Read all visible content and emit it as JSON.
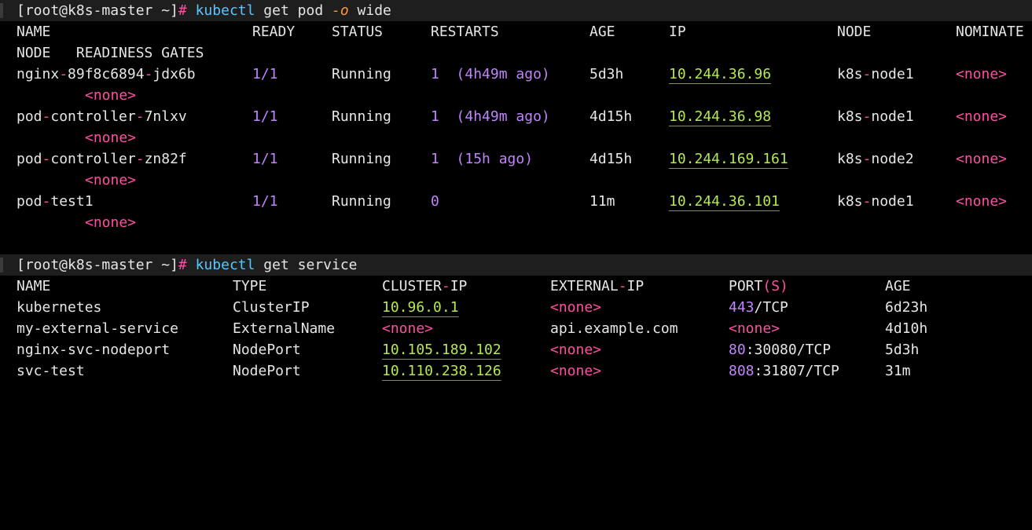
{
  "prompt": {
    "user_host": "[root@k8s-master ~]",
    "hash": "#"
  },
  "cmd1": {
    "program": "kubectl",
    "args": "get pod",
    "flag": "-o",
    "rest": "wide"
  },
  "pods": {
    "headers": [
      "NAME",
      "READY",
      "STATUS",
      "RESTARTS",
      "AGE",
      "IP",
      "NODE",
      "NOMINATE"
    ],
    "header2": "NODE   READINESS GATES",
    "rows": [
      {
        "name_a": "nginx",
        "name_b": "89f8c6894",
        "name_c": "jdx6b",
        "ready": "1/1",
        "status": "Running",
        "restarts_n": "1",
        "restarts_t": "(4h49m ago)",
        "age": "5d3h",
        "ip": "10.244.36.96",
        "node_a": "k8s",
        "node_b": "node1",
        "nominated": "<none>",
        "gates": "<none>"
      },
      {
        "name_a": "pod",
        "name_b": "controller",
        "name_c": "7nlxv",
        "ready": "1/1",
        "status": "Running",
        "restarts_n": "1",
        "restarts_t": "(4h49m ago)",
        "age": "4d15h",
        "ip": "10.244.36.98",
        "node_a": "k8s",
        "node_b": "node1",
        "nominated": "<none>",
        "gates": "<none>"
      },
      {
        "name_a": "pod",
        "name_b": "controller",
        "name_c": "zn82f",
        "ready": "1/1",
        "status": "Running",
        "restarts_n": "1",
        "restarts_t": "(15h ago)",
        "age": "4d15h",
        "ip": "10.244.169.161",
        "node_a": "k8s",
        "node_b": "node2",
        "nominated": "<none>",
        "gates": "<none>"
      },
      {
        "name_a": "pod",
        "name_b": "test1",
        "name_c": "",
        "ready": "1/1",
        "status": "Running",
        "restarts_n": "0",
        "restarts_t": "",
        "age": "11m",
        "ip": "10.244.36.101",
        "node_a": "k8s",
        "node_b": "node1",
        "nominated": "<none>",
        "gates": "<none>"
      }
    ]
  },
  "cmd2": {
    "program": "kubectl",
    "args": "get service"
  },
  "services": {
    "headers": [
      "NAME",
      "TYPE",
      "CLUSTER",
      "IP",
      "EXTERNAL",
      "IP",
      "PORT",
      "(S)",
      "AGE"
    ],
    "rows": [
      {
        "name": "kubernetes",
        "type": "ClusterIP",
        "cluster_ip": "10.96.0.1",
        "external_ip": "<none>",
        "port_a": "443",
        "port_b": "/TCP",
        "age": "6d23h"
      },
      {
        "name": "my-external-service",
        "type": "ExternalName",
        "cluster_ip": "<none>",
        "external_ip": "api.example.com",
        "port_a": "<none>",
        "port_b": "",
        "age": "4d10h"
      },
      {
        "name": "nginx-svc-nodeport",
        "type": "NodePort",
        "cluster_ip": "10.105.189.102",
        "external_ip": "<none>",
        "port_a": "80",
        "port_b": ":30080/TCP",
        "age": "5d3h"
      },
      {
        "name": "svc-test",
        "type": "NodePort",
        "cluster_ip": "10.110.238.126",
        "external_ip": "<none>",
        "port_a": "808",
        "port_b": ":31807/TCP",
        "age": "31m"
      }
    ]
  },
  "colors": {
    "background": "#000000",
    "prompt_bar": "#1e1e1e",
    "command": "#58c6ff",
    "accent_pink": "#ff4fa3",
    "ip_green": "#b5e853",
    "number_purple": "#c084fc",
    "flag_orange": "#ff9a3c"
  }
}
